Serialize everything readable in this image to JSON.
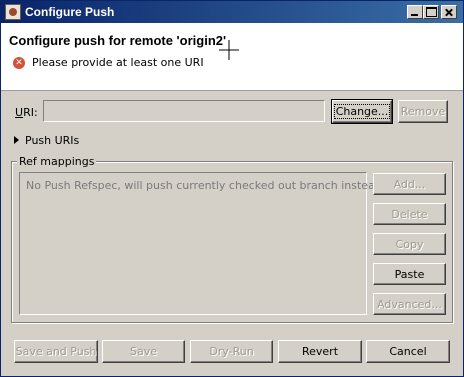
{
  "window": {
    "title": "Configure Push"
  },
  "banner": {
    "title": "Configure push for remote 'origin2'",
    "error_message": "Please provide at least one URI"
  },
  "uri": {
    "label_underlined": "U",
    "label_rest": "RI:",
    "value": "",
    "change_button": "Change...",
    "remove_button": "Remove"
  },
  "push_uris": {
    "label": "Push URIs",
    "expanded": false
  },
  "ref_mappings": {
    "title": "Ref mappings",
    "empty_text": "No Push Refspec, will push currently checked out branch instead.",
    "buttons": {
      "add": "Add...",
      "delete": "Delete",
      "copy": "Copy",
      "paste": "Paste",
      "advanced": "Advanced..."
    }
  },
  "footer": {
    "save_and_push": "Save and Push",
    "save": "Save",
    "dry_run": "Dry-Run",
    "revert": "Revert",
    "cancel": "Cancel"
  },
  "colors": {
    "titlebar_start": "#0a246a",
    "titlebar_end": "#3a6ea5",
    "dialog_bg": "#d4d0c8",
    "error_icon": "#d4503a"
  }
}
